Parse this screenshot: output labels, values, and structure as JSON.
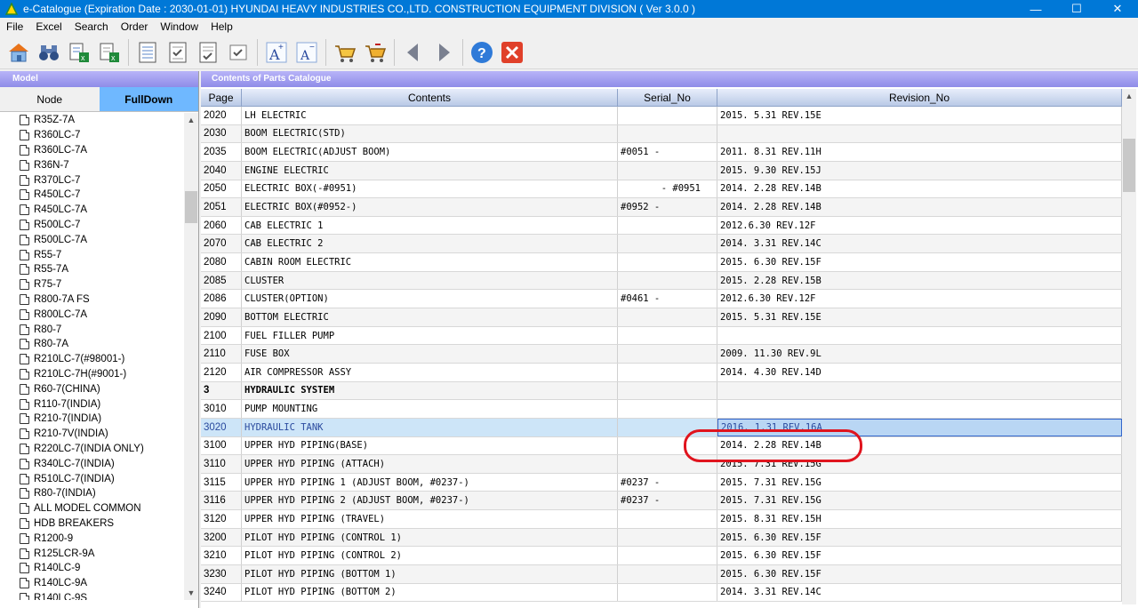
{
  "titlebar": {
    "title": "e-Catalogue (Expiration Date : 2030-01-01)   HYUNDAI HEAVY INDUSTRIES CO.,LTD. CONSTRUCTION EQUIPMENT DIVISION ( Ver 3.0.0 )"
  },
  "menu": [
    "File",
    "Excel",
    "Search",
    "Order",
    "Window",
    "Help"
  ],
  "left_panel": {
    "header": "Model",
    "tabs": {
      "node": "Node",
      "fulldown": "FullDown"
    },
    "items": [
      "R35Z-7A",
      "R360LC-7",
      "R360LC-7A",
      "R36N-7",
      "R370LC-7",
      "R450LC-7",
      "R450LC-7A",
      "R500LC-7",
      "R500LC-7A",
      "R55-7",
      "R55-7A",
      "R75-7",
      "R800-7A FS",
      "R800LC-7A",
      "R80-7",
      "R80-7A",
      "R210LC-7(#98001-)",
      "R210LC-7H(#9001-)",
      "R60-7(CHINA)",
      "R110-7(INDIA)",
      "R210-7(INDIA)",
      "R210-7V(INDIA)",
      "R220LC-7(INDIA ONLY)",
      "R340LC-7(INDIA)",
      "R510LC-7(INDIA)",
      "R80-7(INDIA)",
      "ALL MODEL COMMON",
      "HDB BREAKERS",
      "R1200-9",
      "R125LCR-9A",
      "R140LC-9",
      "R140LC-9A",
      "R140LC-9S"
    ]
  },
  "right_panel": {
    "header": "Contents of Parts Catalogue",
    "columns": {
      "page": "Page",
      "contents": "Contents",
      "serial": "Serial_No",
      "revision": "Revision_No"
    },
    "rows": [
      {
        "page": "2020",
        "contents": "LH ELECTRIC",
        "serial": "",
        "revision": "2015. 5.31  REV.15E"
      },
      {
        "page": "2030",
        "contents": "BOOM ELECTRIC(STD)",
        "serial": "",
        "revision": ""
      },
      {
        "page": "2035",
        "contents": "BOOM ELECTRIC(ADJUST BOOM)",
        "serial": "#0051 -",
        "revision": "2011. 8.31 REV.11H"
      },
      {
        "page": "2040",
        "contents": "ENGINE ELECTRIC",
        "serial": "",
        "revision": "2015. 9.30  REV.15J"
      },
      {
        "page": "2050",
        "contents": "ELECTRIC BOX(-#0951)",
        "serial": "- #0951",
        "revision": "2014. 2.28  REV.14B"
      },
      {
        "page": "2051",
        "contents": "ELECTRIC BOX(#0952-)",
        "serial": "#0952 -",
        "revision": "2014. 2.28  REV.14B"
      },
      {
        "page": "2060",
        "contents": "CAB ELECTRIC 1",
        "serial": "",
        "revision": "2012.6.30  REV.12F"
      },
      {
        "page": "2070",
        "contents": "CAB ELECTRIC 2",
        "serial": "",
        "revision": "2014. 3.31  REV.14C"
      },
      {
        "page": "2080",
        "contents": "CABIN ROOM ELECTRIC",
        "serial": "",
        "revision": "2015. 6.30  REV.15F"
      },
      {
        "page": "2085",
        "contents": "CLUSTER",
        "serial": "",
        "revision": "2015. 2.28  REV.15B"
      },
      {
        "page": "2086",
        "contents": "CLUSTER(OPTION)",
        "serial": "#0461 -",
        "revision": "2012.6.30  REV.12F"
      },
      {
        "page": "2090",
        "contents": "BOTTOM ELECTRIC",
        "serial": "",
        "revision": "2015. 5.31  REV.15E"
      },
      {
        "page": "2100",
        "contents": "FUEL FILLER PUMP",
        "serial": "",
        "revision": ""
      },
      {
        "page": "2110",
        "contents": "FUSE BOX",
        "serial": "",
        "revision": "2009. 11.30 REV.9L"
      },
      {
        "page": "2120",
        "contents": "AIR COMPRESSOR ASSY",
        "serial": "",
        "revision": "2014. 4.30  REV.14D"
      },
      {
        "page": "3",
        "contents": "HYDRAULIC SYSTEM",
        "serial": "",
        "revision": "",
        "bold": true
      },
      {
        "page": "3010",
        "contents": "PUMP MOUNTING",
        "serial": "",
        "revision": ""
      },
      {
        "page": "3020",
        "contents": "HYDRAULIC TANK",
        "serial": "",
        "revision": "2016. 1.31  REV.16A",
        "selected": true
      },
      {
        "page": "3100",
        "contents": "UPPER HYD PIPING(BASE)",
        "serial": "",
        "revision": "2014. 2.28  REV.14B"
      },
      {
        "page": "3110",
        "contents": "UPPER HYD PIPING (ATTACH)",
        "serial": "",
        "revision": "2015. 7.31  REV.15G"
      },
      {
        "page": "3115",
        "contents": "UPPER HYD PIPING 1 (ADJUST BOOM, #0237-)",
        "serial": "#0237 -",
        "revision": "2015. 7.31  REV.15G"
      },
      {
        "page": "3116",
        "contents": "UPPER HYD PIPING 2 (ADJUST BOOM, #0237-)",
        "serial": "#0237 -",
        "revision": "2015. 7.31  REV.15G"
      },
      {
        "page": "3120",
        "contents": "UPPER HYD PIPING (TRAVEL)",
        "serial": "",
        "revision": "2015. 8.31  REV.15H"
      },
      {
        "page": "3200",
        "contents": "PILOT HYD PIPING (CONTROL 1)",
        "serial": "",
        "revision": "2015. 6.30  REV.15F"
      },
      {
        "page": "3210",
        "contents": "PILOT HYD PIPING (CONTROL 2)",
        "serial": "",
        "revision": "2015. 6.30  REV.15F"
      },
      {
        "page": "3230",
        "contents": "PILOT HYD PIPING (BOTTOM 1)",
        "serial": "",
        "revision": "2015. 6.30  REV.15F"
      },
      {
        "page": "3240",
        "contents": "PILOT HYD PIPING (BOTTOM 2)",
        "serial": "",
        "revision": "2014. 3.31  REV.14C"
      }
    ]
  },
  "colors": {
    "titlebar": "#0078d7",
    "tab_active": "#6fb8ff",
    "highlight": "#e0141e",
    "selected_row": "#cde5f8"
  }
}
